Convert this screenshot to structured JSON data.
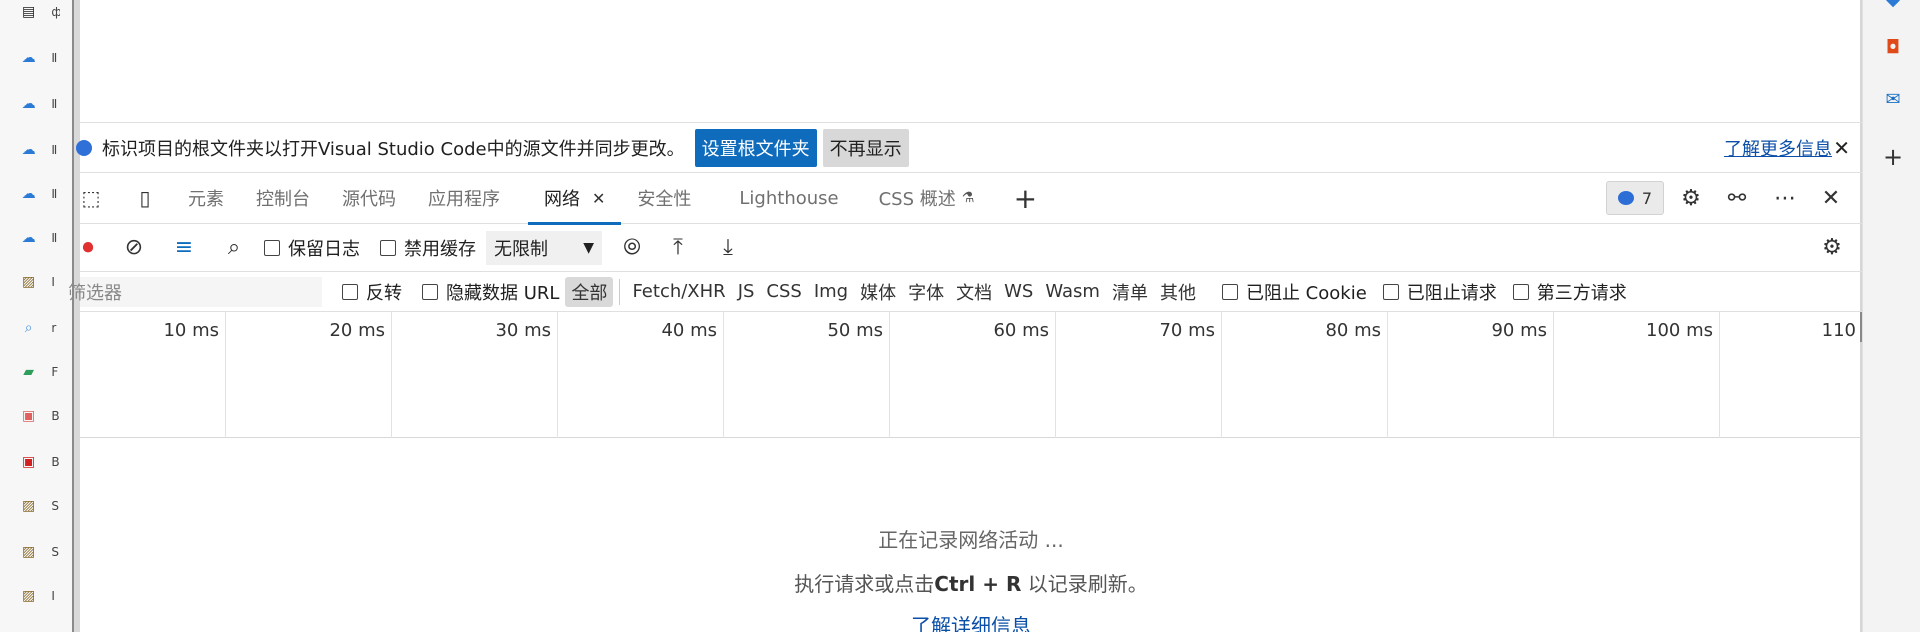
{
  "favorites": [
    {
      "icon": "calendar-icon",
      "label": "ф"
    },
    {
      "icon": "cloud-icon",
      "label": "Ⅱ"
    },
    {
      "icon": "cloud-icon",
      "label": "Ⅱ"
    },
    {
      "icon": "cloud-icon",
      "label": "Ⅱ"
    },
    {
      "icon": "cloud-icon",
      "label": "Ⅱ"
    },
    {
      "icon": "cloud-icon",
      "label": "Ⅱ"
    },
    {
      "icon": "image-icon",
      "label": "I"
    },
    {
      "icon": "search-icon",
      "label": "r"
    },
    {
      "icon": "book-icon",
      "label": "F"
    },
    {
      "icon": "pdf-icon",
      "label": "B"
    },
    {
      "icon": "pdf-icon",
      "label": "B"
    },
    {
      "icon": "image-icon",
      "label": "S"
    },
    {
      "icon": "image-icon",
      "label": "S"
    },
    {
      "icon": "image-icon",
      "label": "I"
    }
  ],
  "infobar": {
    "message": "标识项目的根文件夹以打开Visual Studio Code中的源文件并同步更改。",
    "set_root_label": "设置根文件夹",
    "dont_show_label": "不再显示",
    "learn_more_label": "了解更多信息",
    "close_glyph": "✕"
  },
  "tabs": {
    "items": [
      "元素",
      "控制台",
      "源代码",
      "应用程序",
      "网络",
      "安全性",
      "Lighthouse",
      "CSS 概述"
    ],
    "active": "网络",
    "close_glyph": "✕",
    "add_glyph": "+",
    "issues_count": "7"
  },
  "toolbar": {
    "preserve_log_label": "保留日志",
    "disable_cache_label": "禁用缓存",
    "throttle_value": "无限制"
  },
  "filterbar": {
    "filter_placeholder": "筛选器",
    "invert_label": "反转",
    "hide_data_urls_label": "隐藏数据 URL",
    "types": [
      "全部",
      "Fetch/XHR",
      "JS",
      "CSS",
      "Img",
      "媒体",
      "字体",
      "文档",
      "WS",
      "Wasm",
      "清单",
      "其他"
    ],
    "selected_type": "全部",
    "blocked_cookies_label": "已阻止 Cookie",
    "blocked_requests_label": "已阻止请求",
    "third_party_label": "第三方请求"
  },
  "timeline": {
    "ticks": [
      "10 ms",
      "20 ms",
      "30 ms",
      "40 ms",
      "50 ms",
      "60 ms",
      "70 ms",
      "80 ms",
      "90 ms",
      "100 ms",
      "110"
    ]
  },
  "empty_state": {
    "line1": "正在记录网络活动 ...",
    "line2_prefix": "执行请求或点击",
    "line2_key": "Ctrl + R",
    "line2_suffix": "以记录刷新。",
    "learn_more": "了解详细信息"
  },
  "colors": {
    "accent": "#0f6cbd",
    "link": "#0b4fa8",
    "record_red": "#e03030"
  }
}
